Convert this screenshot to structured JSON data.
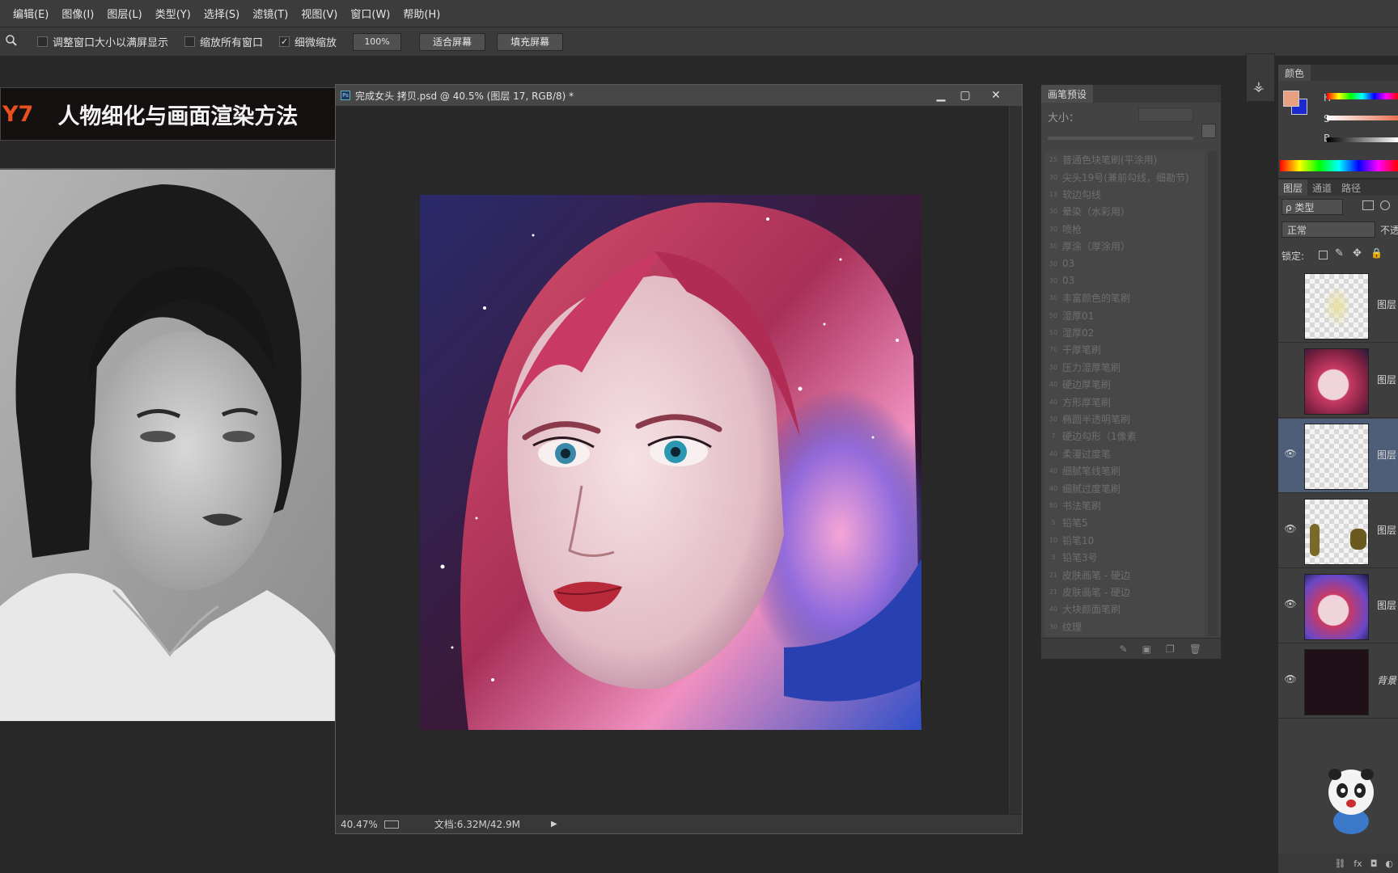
{
  "menu": [
    "编辑(E)",
    "图像(I)",
    "图层(L)",
    "类型(Y)",
    "选择(S)",
    "滤镜(T)",
    "视图(V)",
    "窗口(W)",
    "帮助(H)"
  ],
  "options": {
    "resize_windows_label": "调整窗口大小以满屏显示",
    "zoom_all_label": "缩放所有窗口",
    "scrubby_label": "细微缩放",
    "zoom_value": "100%",
    "fit_screen_label": "适合屏幕",
    "fill_screen_label": "填充屏幕"
  },
  "banner": {
    "day": "Y7",
    "title": "人物细化与画面渲染方法"
  },
  "document": {
    "title": "完成女头 拷贝.psd @ 40.5% (图层 17, RGB/8) *",
    "zoom": "40.47%",
    "doc_size": "文档:6.32M/42.9M"
  },
  "brush_panel": {
    "tab": "画笔预设",
    "size_label": "大小：",
    "brushes": [
      {
        "num": "25",
        "name": "普通色块笔刷(平涂用)"
      },
      {
        "num": "30",
        "name": "尖头19号(兼前勾线，细勘节)"
      },
      {
        "num": "13",
        "name": "软边勾线"
      },
      {
        "num": "30",
        "name": "晕染（水彩用）"
      },
      {
        "num": "30",
        "name": "喷枪"
      },
      {
        "num": "30",
        "name": "厚涂（厚涂用）"
      },
      {
        "num": "30",
        "name": "03"
      },
      {
        "num": "30",
        "name": "03"
      },
      {
        "num": "30",
        "name": "丰富颜色的笔刷"
      },
      {
        "num": "50",
        "name": "湿厚01"
      },
      {
        "num": "50",
        "name": "湿厚02"
      },
      {
        "num": "70",
        "name": "干厚笔刷"
      },
      {
        "num": "30",
        "name": "压力湿厚笔刷"
      },
      {
        "num": "40",
        "name": "硬边厚笔刷"
      },
      {
        "num": "40",
        "name": "方形厚笔刷"
      },
      {
        "num": "30",
        "name": "椭圆半透明笔刷"
      },
      {
        "num": "7",
        "name": "硬边勾形（1像素"
      },
      {
        "num": "40",
        "name": "柔漫过度笔"
      },
      {
        "num": "40",
        "name": "细腻笔线笔刷"
      },
      {
        "num": "40",
        "name": "细腻过度笔刷"
      },
      {
        "num": "80",
        "name": "书法笔刷"
      },
      {
        "num": "5",
        "name": "铅笔5"
      },
      {
        "num": "10",
        "name": "铅笔10"
      },
      {
        "num": "3",
        "name": "铅笔3号"
      },
      {
        "num": "21",
        "name": "皮肤画笔 - 硬边"
      },
      {
        "num": "21",
        "name": "皮肤画笔 - 硬边"
      },
      {
        "num": "40",
        "name": "大块颜面笔刷"
      },
      {
        "num": "30",
        "name": "纹理"
      }
    ]
  },
  "color_panel": {
    "tab": "颜色",
    "h": "H",
    "s": "S",
    "b": "B",
    "fg": "#e8a080",
    "bg": "#1a2ad0"
  },
  "layers_panel": {
    "tabs": [
      "图层",
      "通道",
      "路径"
    ],
    "filter": "ρ 类型",
    "blend": "正常",
    "opacity_label": "不透",
    "lock_label": "锁定:",
    "layers": [
      {
        "name": "图层",
        "visible": false
      },
      {
        "name": "图层",
        "visible": false
      },
      {
        "name": "图层",
        "visible": true
      },
      {
        "name": "图层",
        "visible": true
      },
      {
        "name": "图层",
        "visible": true
      },
      {
        "name": "背景",
        "visible": true
      }
    ]
  }
}
